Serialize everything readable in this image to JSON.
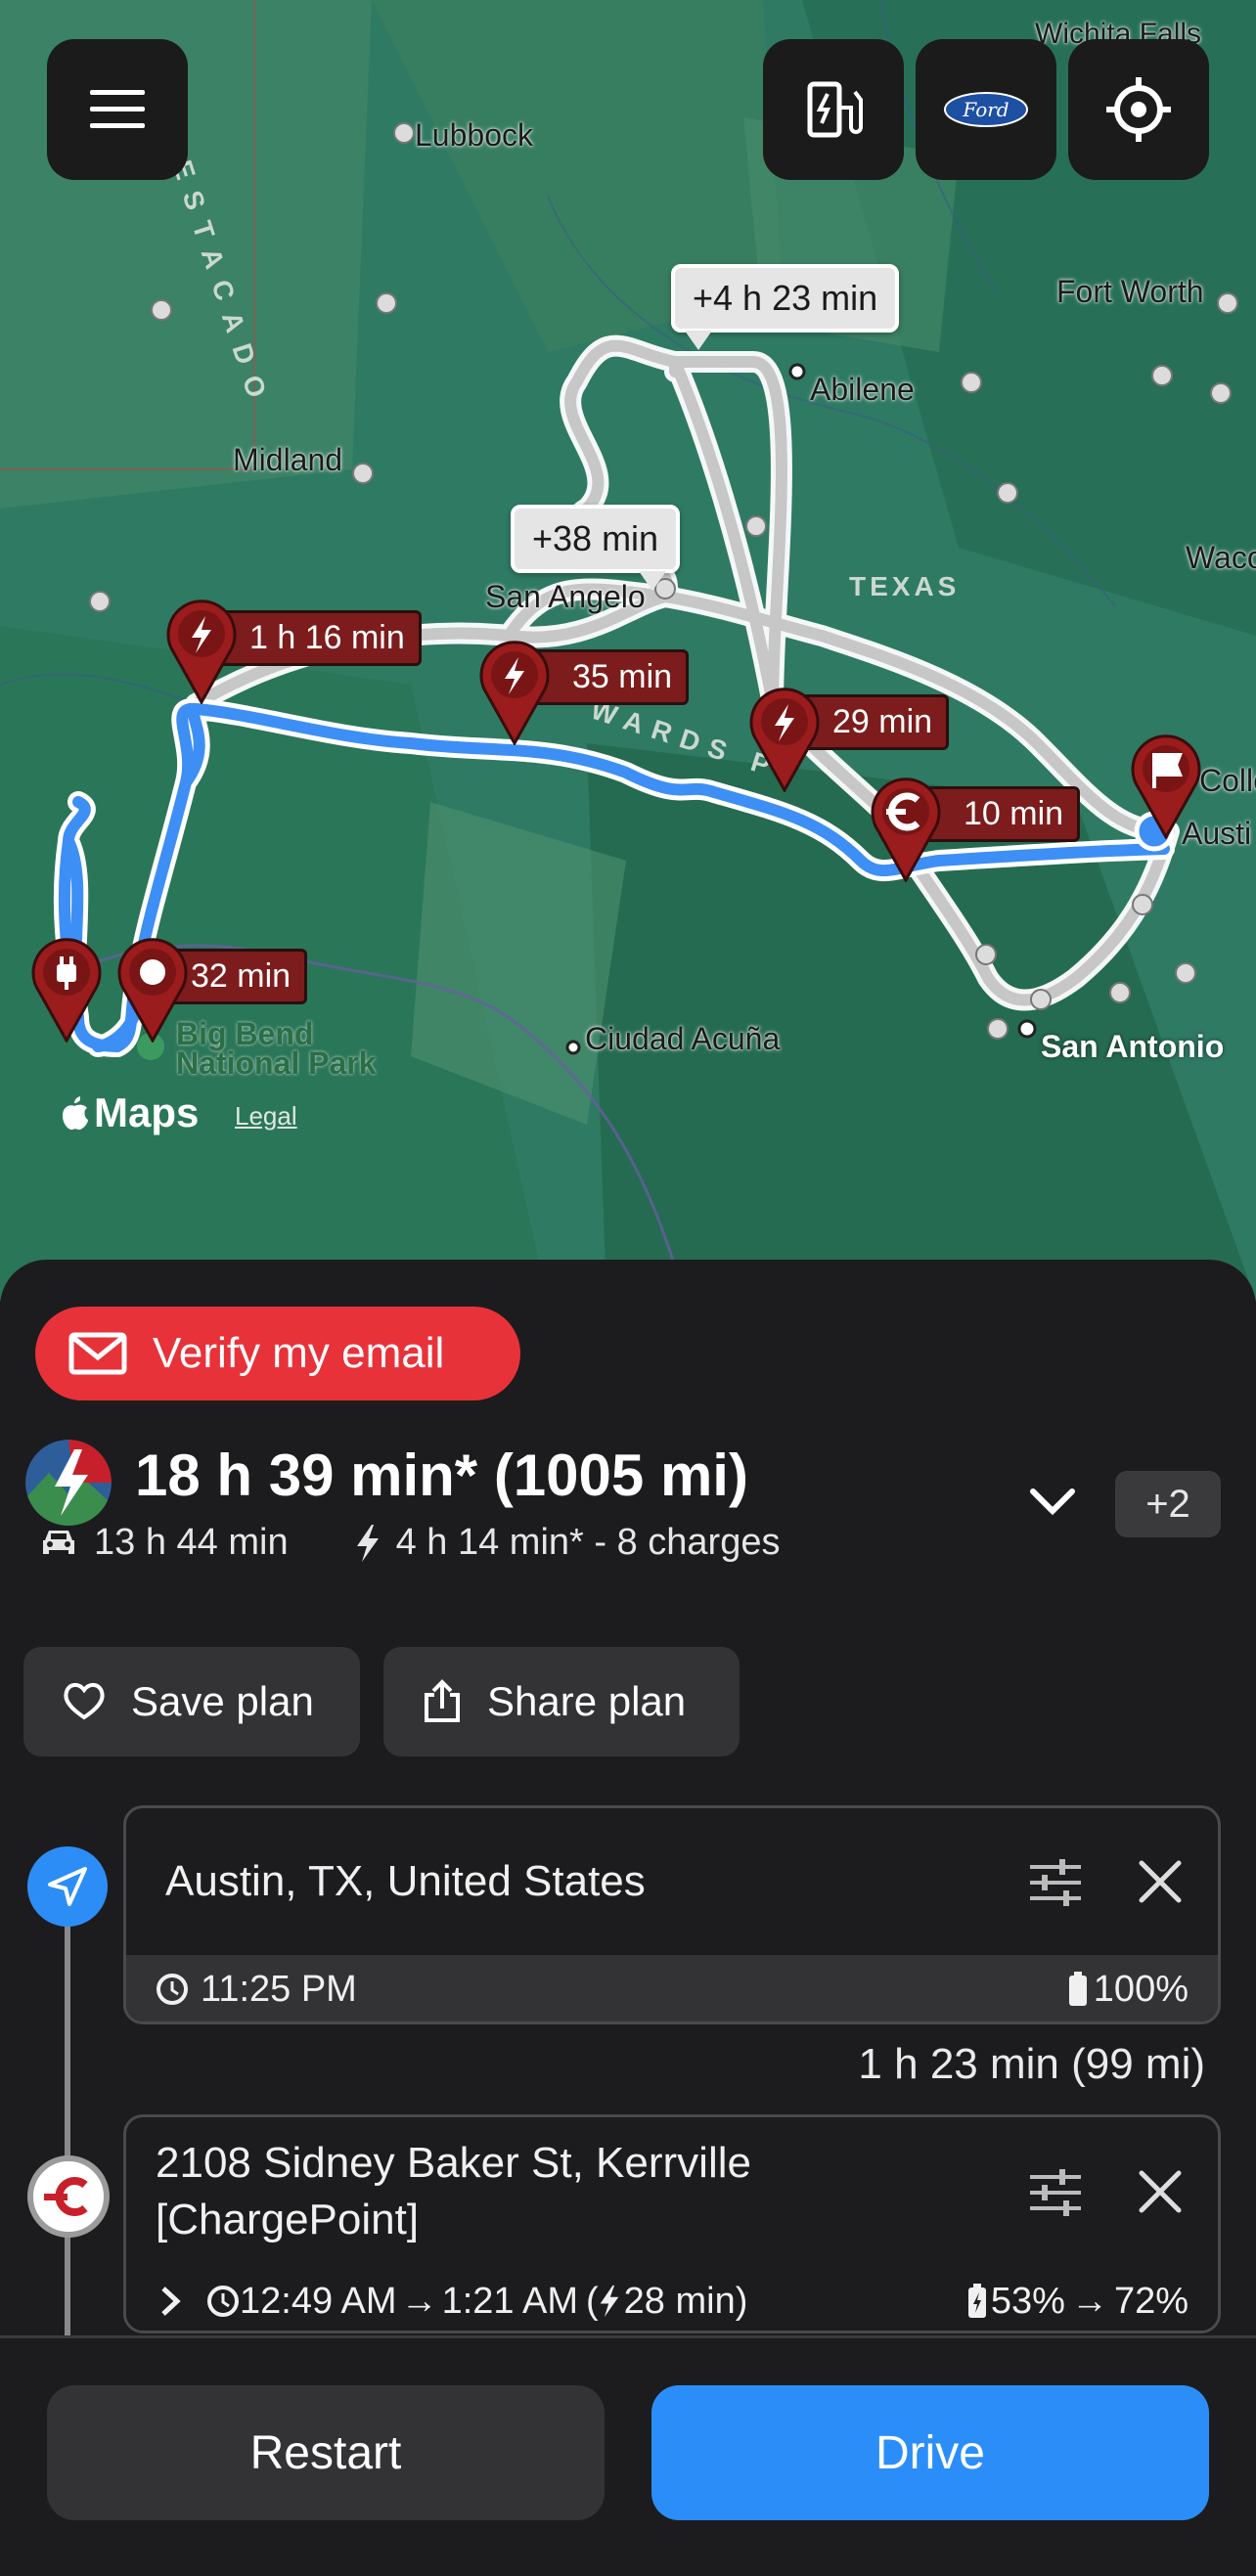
{
  "map": {
    "cities": [
      {
        "id": "wichita-falls",
        "label": "Wichita Falls"
      },
      {
        "id": "lubbock",
        "label": "Lubbock"
      },
      {
        "id": "fort-worth",
        "label": "Fort Worth"
      },
      {
        "id": "abilene",
        "label": "Abilene"
      },
      {
        "id": "midland",
        "label": "Midland"
      },
      {
        "id": "san-angelo",
        "label": "San Angelo"
      },
      {
        "id": "waco",
        "label": "Waco"
      },
      {
        "id": "college",
        "label": "Colle"
      },
      {
        "id": "austin",
        "label": "Austi"
      },
      {
        "id": "ciudad-acuna",
        "label": "Ciudad Acuña"
      },
      {
        "id": "san-antonio",
        "label": "San Antonio"
      }
    ],
    "regions": {
      "texas": "TEXAS",
      "estacado": "ESTACADO",
      "edwards": "WARDS P"
    },
    "park_line1": "Big Bend",
    "park_line2": "National Park",
    "alt_routes": [
      {
        "id": "alt-1",
        "label": "+4 h 23 min"
      },
      {
        "id": "alt-2",
        "label": "+38 min"
      }
    ],
    "charge_stops": [
      {
        "id": "stop-1",
        "label": "1 h 16 min"
      },
      {
        "id": "stop-2",
        "label": "35 min"
      },
      {
        "id": "stop-3",
        "label": "29 min"
      },
      {
        "id": "stop-4",
        "label": "10 min"
      },
      {
        "id": "stop-5",
        "label": "32 min"
      }
    ],
    "attribution": "Maps",
    "legal": "Legal"
  },
  "header_buttons": {
    "menu_icon": "hamburger-menu-icon",
    "charger_icon": "ev-charger-icon",
    "brand": "Ford",
    "locate_icon": "crosshair-icon"
  },
  "verify": {
    "label": "Verify my email"
  },
  "summary": {
    "title": "18 h 39 min* (1005 mi)",
    "drive_time": "13 h 44 min",
    "charge_info": "4 h 14 min* - 8 charges",
    "extra_count": "+2"
  },
  "actions": {
    "save": "Save plan",
    "share": "Share plan"
  },
  "stops": [
    {
      "address": "Austin, TX, United States",
      "time": "11:25 PM",
      "battery": "100%"
    },
    {
      "leg": "1 h 23 min (99 mi)",
      "address_line1": "2108 Sidney Baker St, Kerrville",
      "address_line2": "[ChargePoint]",
      "arrive": "12:49 AM",
      "depart": "1:21 AM",
      "charge_duration": "28 min",
      "battery_from": "53%",
      "battery_to": "72%"
    }
  ],
  "bottom": {
    "restart": "Restart",
    "drive": "Drive"
  },
  "colors": {
    "accent_blue": "#2b8ef8",
    "verify_red": "#e8323a",
    "pin_red": "#9b1c1c",
    "map_green": "#2f7a63"
  }
}
